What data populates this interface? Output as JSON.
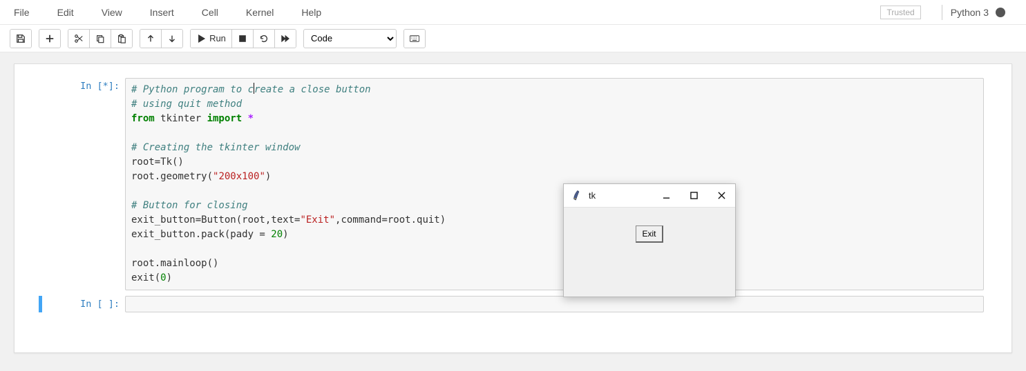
{
  "menu": {
    "items": [
      "File",
      "Edit",
      "View",
      "Insert",
      "Cell",
      "Kernel",
      "Help"
    ],
    "trusted": "Trusted",
    "kernel_name": "Python 3"
  },
  "toolbar": {
    "run_label": "Run",
    "cell_type": "Code"
  },
  "cells": [
    {
      "prompt": "In [*]:",
      "code": {
        "c1": "# Python program to create a close button",
        "c2": "# using quit method",
        "kw_from": "from",
        "mod": " tkinter ",
        "kw_import": "import",
        "star": " *",
        "c3": "# Creating the tkinter window",
        "l_rootTk": "root=Tk()",
        "l_geom_a": "root.geometry(",
        "s_geom": "\"200x100\"",
        "l_geom_b": ")",
        "c4": "# Button for closing",
        "l_btn_a": "exit_button=Button(root,text=",
        "s_exit": "\"Exit\"",
        "l_btn_b": ",command=root.quit)",
        "l_pack": "exit_button.pack(pady = ",
        "n_pady": "20",
        "l_pack_b": ")",
        "l_mainloop": "root.mainloop()",
        "l_exit_a": "exit(",
        "n_zero": "0",
        "l_exit_b": ")"
      }
    },
    {
      "prompt": "In [ ]:",
      "code_text": ""
    }
  ],
  "tk_window": {
    "title": "tk",
    "button_label": "Exit"
  }
}
